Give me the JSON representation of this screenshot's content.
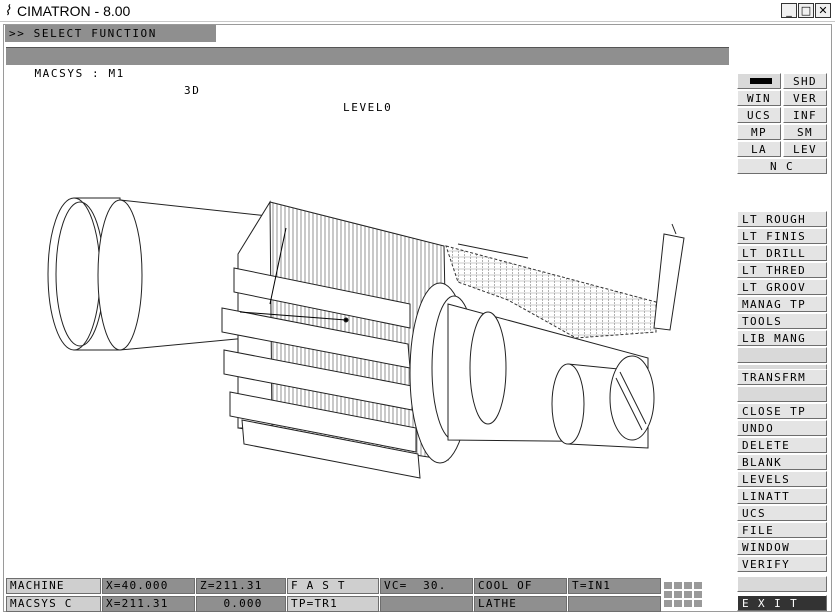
{
  "window": {
    "logo_glyph": "⌇",
    "title": "CIMATRON - 8.00",
    "min_glyph": "_",
    "max_glyph": "□",
    "close_glyph": "✕"
  },
  "prompt": ">> SELECT FUNCTION",
  "status": {
    "macsys": "MACSYS : M1",
    "mode": "3D",
    "level": "LEVEL0"
  },
  "side_menu": {
    "top": {
      "shd": "SHD",
      "win": "WIN",
      "ver": "VER",
      "ucs": "UCS",
      "inf": "INF",
      "mp": "MP",
      "sm": "SM",
      "la": "LA",
      "lev": "LEV",
      "nc": "N C"
    },
    "functions": [
      "LT ROUGH",
      "LT FINIS",
      "LT DRILL",
      "LT THRED",
      "LT GROOV",
      "MANAG TP",
      "TOOLS",
      "LIB MANG"
    ],
    "transform": "TRANSFRM",
    "edit": [
      "CLOSE TP",
      "UNDO",
      "DELETE",
      "BLANK",
      "LEVELS",
      "LINATT",
      "UCS",
      "FILE",
      "WINDOW",
      "VERIFY"
    ],
    "exit": "E X I T"
  },
  "bottom_status": {
    "row1": [
      "MACHINE",
      "X=40.000",
      "Z=211.31",
      "F A S T",
      "VC=  30.",
      "COOL OF",
      "T=IN1"
    ],
    "row2": [
      "MACSYS C",
      "X=211.31",
      "   0.000",
      "TP=TR1",
      "",
      "LATHE",
      ""
    ]
  },
  "colors": {
    "bar_gray": "#8f8f8f",
    "button_face": "#e4e4e4",
    "background": "#ffffff"
  }
}
